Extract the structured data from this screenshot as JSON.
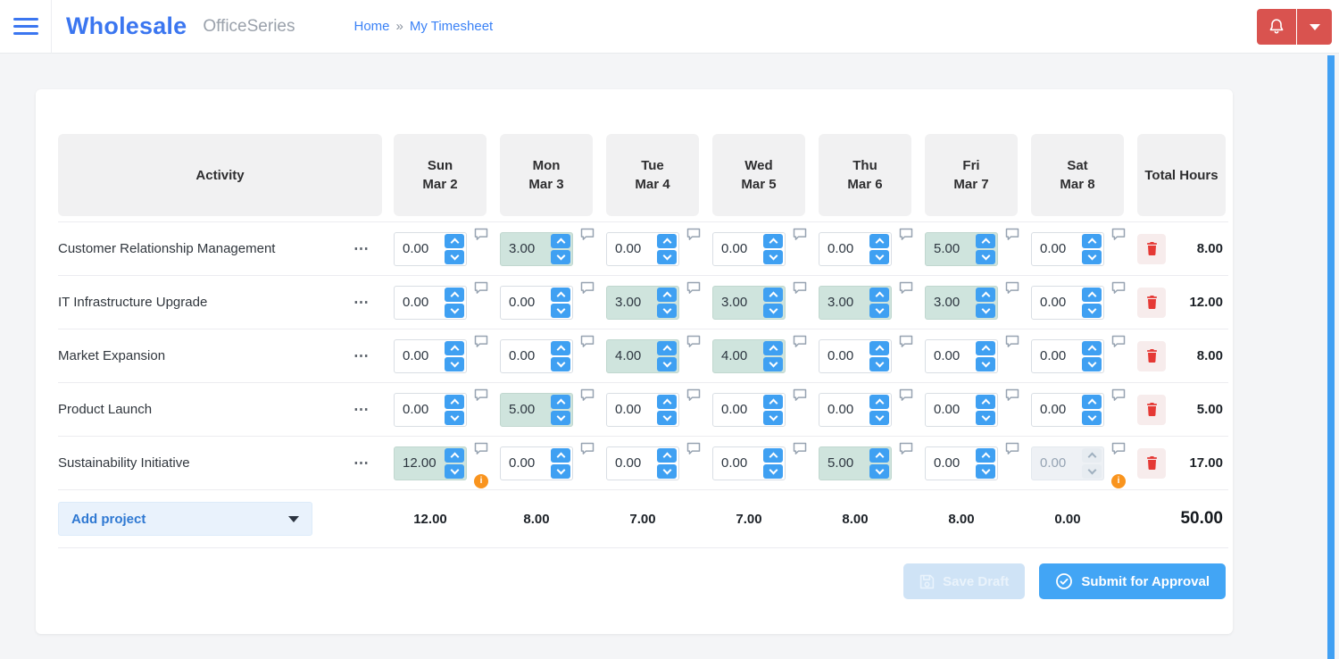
{
  "header": {
    "brand": "Wholesale",
    "brand_suffix": "OfficeSeries",
    "breadcrumb": {
      "home": "Home",
      "separator": "»",
      "current": "My Timesheet"
    }
  },
  "icons": {
    "row_menu": "⋯"
  },
  "colors": {
    "accent_blue": "#42a5f5",
    "logo_blue": "#3b76f0",
    "header_button_red": "#d9534f",
    "highlight_teal": "#cfe4dd",
    "warning_orange": "#f9941e",
    "trash_red": "#e53935"
  },
  "timesheet": {
    "activity_header": "Activity",
    "total_header": "Total Hours",
    "columns": [
      {
        "day": "Sun",
        "date": "Mar 2"
      },
      {
        "day": "Mon",
        "date": "Mar 3"
      },
      {
        "day": "Tue",
        "date": "Mar 4"
      },
      {
        "day": "Wed",
        "date": "Mar 5"
      },
      {
        "day": "Thu",
        "date": "Mar 6"
      },
      {
        "day": "Fri",
        "date": "Mar 7"
      },
      {
        "day": "Sat",
        "date": "Mar 8"
      }
    ],
    "rows": [
      {
        "activity": "Customer Relationship Management",
        "total": "8.00",
        "cells": [
          {
            "value": "0.00"
          },
          {
            "value": "3.00",
            "highlight": true
          },
          {
            "value": "0.00"
          },
          {
            "value": "0.00"
          },
          {
            "value": "0.00"
          },
          {
            "value": "5.00",
            "highlight": true
          },
          {
            "value": "0.00"
          }
        ]
      },
      {
        "activity": "IT Infrastructure Upgrade",
        "total": "12.00",
        "cells": [
          {
            "value": "0.00"
          },
          {
            "value": "0.00"
          },
          {
            "value": "3.00",
            "highlight": true
          },
          {
            "value": "3.00",
            "highlight": true
          },
          {
            "value": "3.00",
            "highlight": true
          },
          {
            "value": "3.00",
            "highlight": true
          },
          {
            "value": "0.00"
          }
        ]
      },
      {
        "activity": "Market Expansion",
        "total": "8.00",
        "cells": [
          {
            "value": "0.00"
          },
          {
            "value": "0.00"
          },
          {
            "value": "4.00",
            "highlight": true
          },
          {
            "value": "4.00",
            "highlight": true
          },
          {
            "value": "0.00"
          },
          {
            "value": "0.00"
          },
          {
            "value": "0.00"
          }
        ]
      },
      {
        "activity": "Product Launch",
        "total": "5.00",
        "cells": [
          {
            "value": "0.00"
          },
          {
            "value": "5.00",
            "highlight": true
          },
          {
            "value": "0.00"
          },
          {
            "value": "0.00"
          },
          {
            "value": "0.00"
          },
          {
            "value": "0.00"
          },
          {
            "value": "0.00"
          }
        ]
      },
      {
        "activity": "Sustainability Initiative",
        "total": "17.00",
        "cells": [
          {
            "value": "12.00",
            "highlight": true,
            "warning": true
          },
          {
            "value": "0.00"
          },
          {
            "value": "0.00"
          },
          {
            "value": "0.00"
          },
          {
            "value": "5.00",
            "highlight": true
          },
          {
            "value": "0.00"
          },
          {
            "value": "0.00",
            "disabled": true,
            "warning": true
          }
        ]
      }
    ],
    "footer": {
      "add_project_label": "Add project",
      "day_totals": [
        "12.00",
        "8.00",
        "7.00",
        "7.00",
        "8.00",
        "8.00",
        "0.00"
      ],
      "grand_total": "50.00"
    },
    "actions": {
      "save_draft": "Save Draft",
      "submit": "Submit for Approval"
    }
  }
}
